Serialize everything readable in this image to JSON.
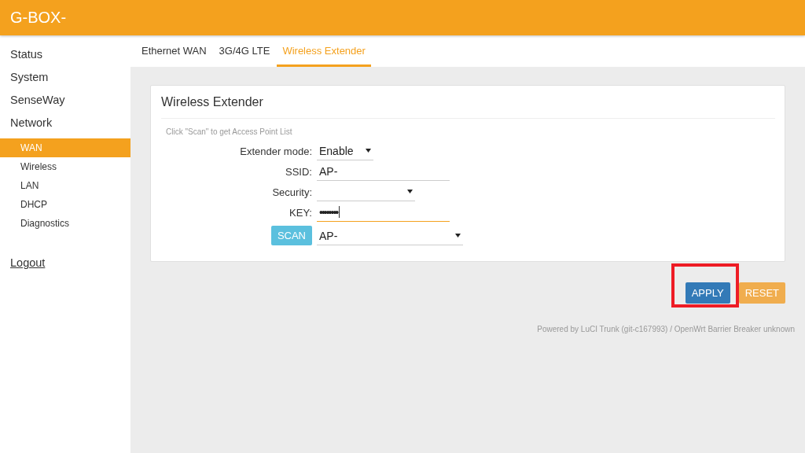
{
  "header": {
    "brand": "G-BOX-"
  },
  "sidebar": {
    "items": [
      {
        "label": "Status",
        "selected": false
      },
      {
        "label": "System",
        "selected": false
      },
      {
        "label": "SenseWay",
        "selected": false
      },
      {
        "label": "Network",
        "selected": false,
        "children": [
          {
            "label": "WAN",
            "selected": true
          },
          {
            "label": "Wireless",
            "selected": false
          },
          {
            "label": "LAN",
            "selected": false
          },
          {
            "label": "DHCP",
            "selected": false
          },
          {
            "label": "Diagnostics",
            "selected": false
          }
        ]
      }
    ],
    "logout": "Logout"
  },
  "tabs": [
    {
      "label": "Ethernet WAN",
      "selected": false
    },
    {
      "label": "3G/4G LTE",
      "selected": false
    },
    {
      "label": "Wireless Extender",
      "selected": true
    }
  ],
  "card": {
    "title": "Wireless Extender",
    "hint": "Click \"Scan\" to get Access Point List",
    "rows": [
      {
        "kind": "select",
        "label": "Extender mode:",
        "value": "Enable",
        "focused": false
      },
      {
        "kind": "text",
        "label": "SSID:",
        "value": "AP-",
        "focused": false
      },
      {
        "kind": "select",
        "label": "Security:",
        "focused": false
      },
      {
        "kind": "password",
        "label": "KEY:",
        "value": "••••••••",
        "focused": true
      },
      {
        "kind": "scan",
        "button": "SCAN",
        "value": "AP-",
        "focused": false
      }
    ]
  },
  "actions": [
    {
      "label": "APPLY",
      "kind": "primary",
      "highlighted": true
    },
    {
      "label": "RESET",
      "kind": "warning",
      "highlighted": false
    }
  ],
  "footer": "Powered by LuCI Trunk (git-c167993) / OpenWrt Barrier Breaker unknown"
}
